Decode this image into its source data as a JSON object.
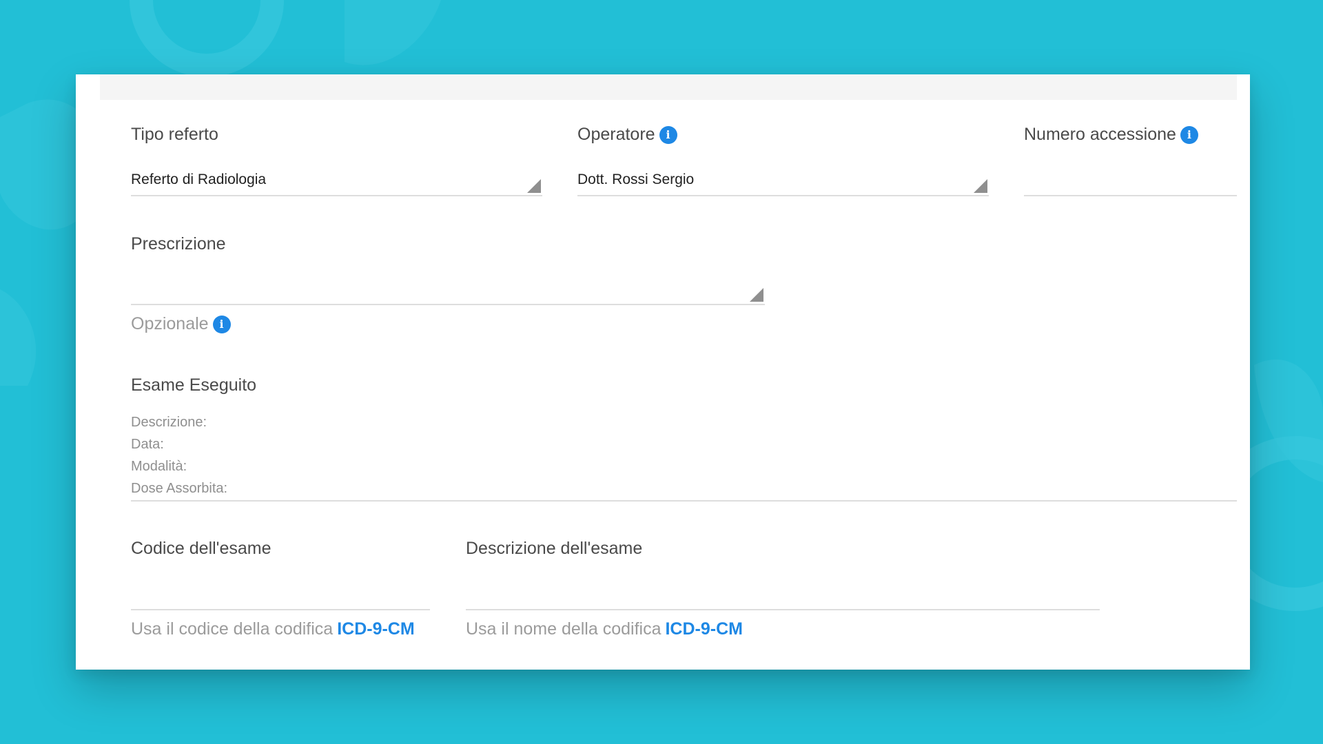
{
  "form": {
    "tipo_referto": {
      "label": "Tipo referto",
      "value": "Referto di Radiologia"
    },
    "operatore": {
      "label": "Operatore",
      "value": "Dott. Rossi Sergio"
    },
    "numero_accessione": {
      "label": "Numero accessione",
      "value": ""
    },
    "prescrizione": {
      "label": "Prescrizione",
      "value": "",
      "hint": "Opzionale"
    },
    "esame_eseguito": {
      "title": "Esame Eseguito",
      "descrizione": "Descrizione:",
      "data": "Data:",
      "modalita": "Modalità:",
      "dose": "Dose Assorbita:"
    },
    "codice_esame": {
      "label": "Codice dell'esame",
      "hint_prefix": "Usa il codice della codifica",
      "hint_link": "ICD-9-CM"
    },
    "descrizione_esame": {
      "label": "Descrizione dell'esame",
      "hint_prefix": "Usa il nome della codifica",
      "hint_link": "ICD-9-CM"
    }
  },
  "icons": {
    "info": "info-icon",
    "dropdown": "dropdown-caret-icon"
  },
  "colors": {
    "background": "#22bfd6",
    "accent": "#1e88e5",
    "card": "#ffffff"
  }
}
